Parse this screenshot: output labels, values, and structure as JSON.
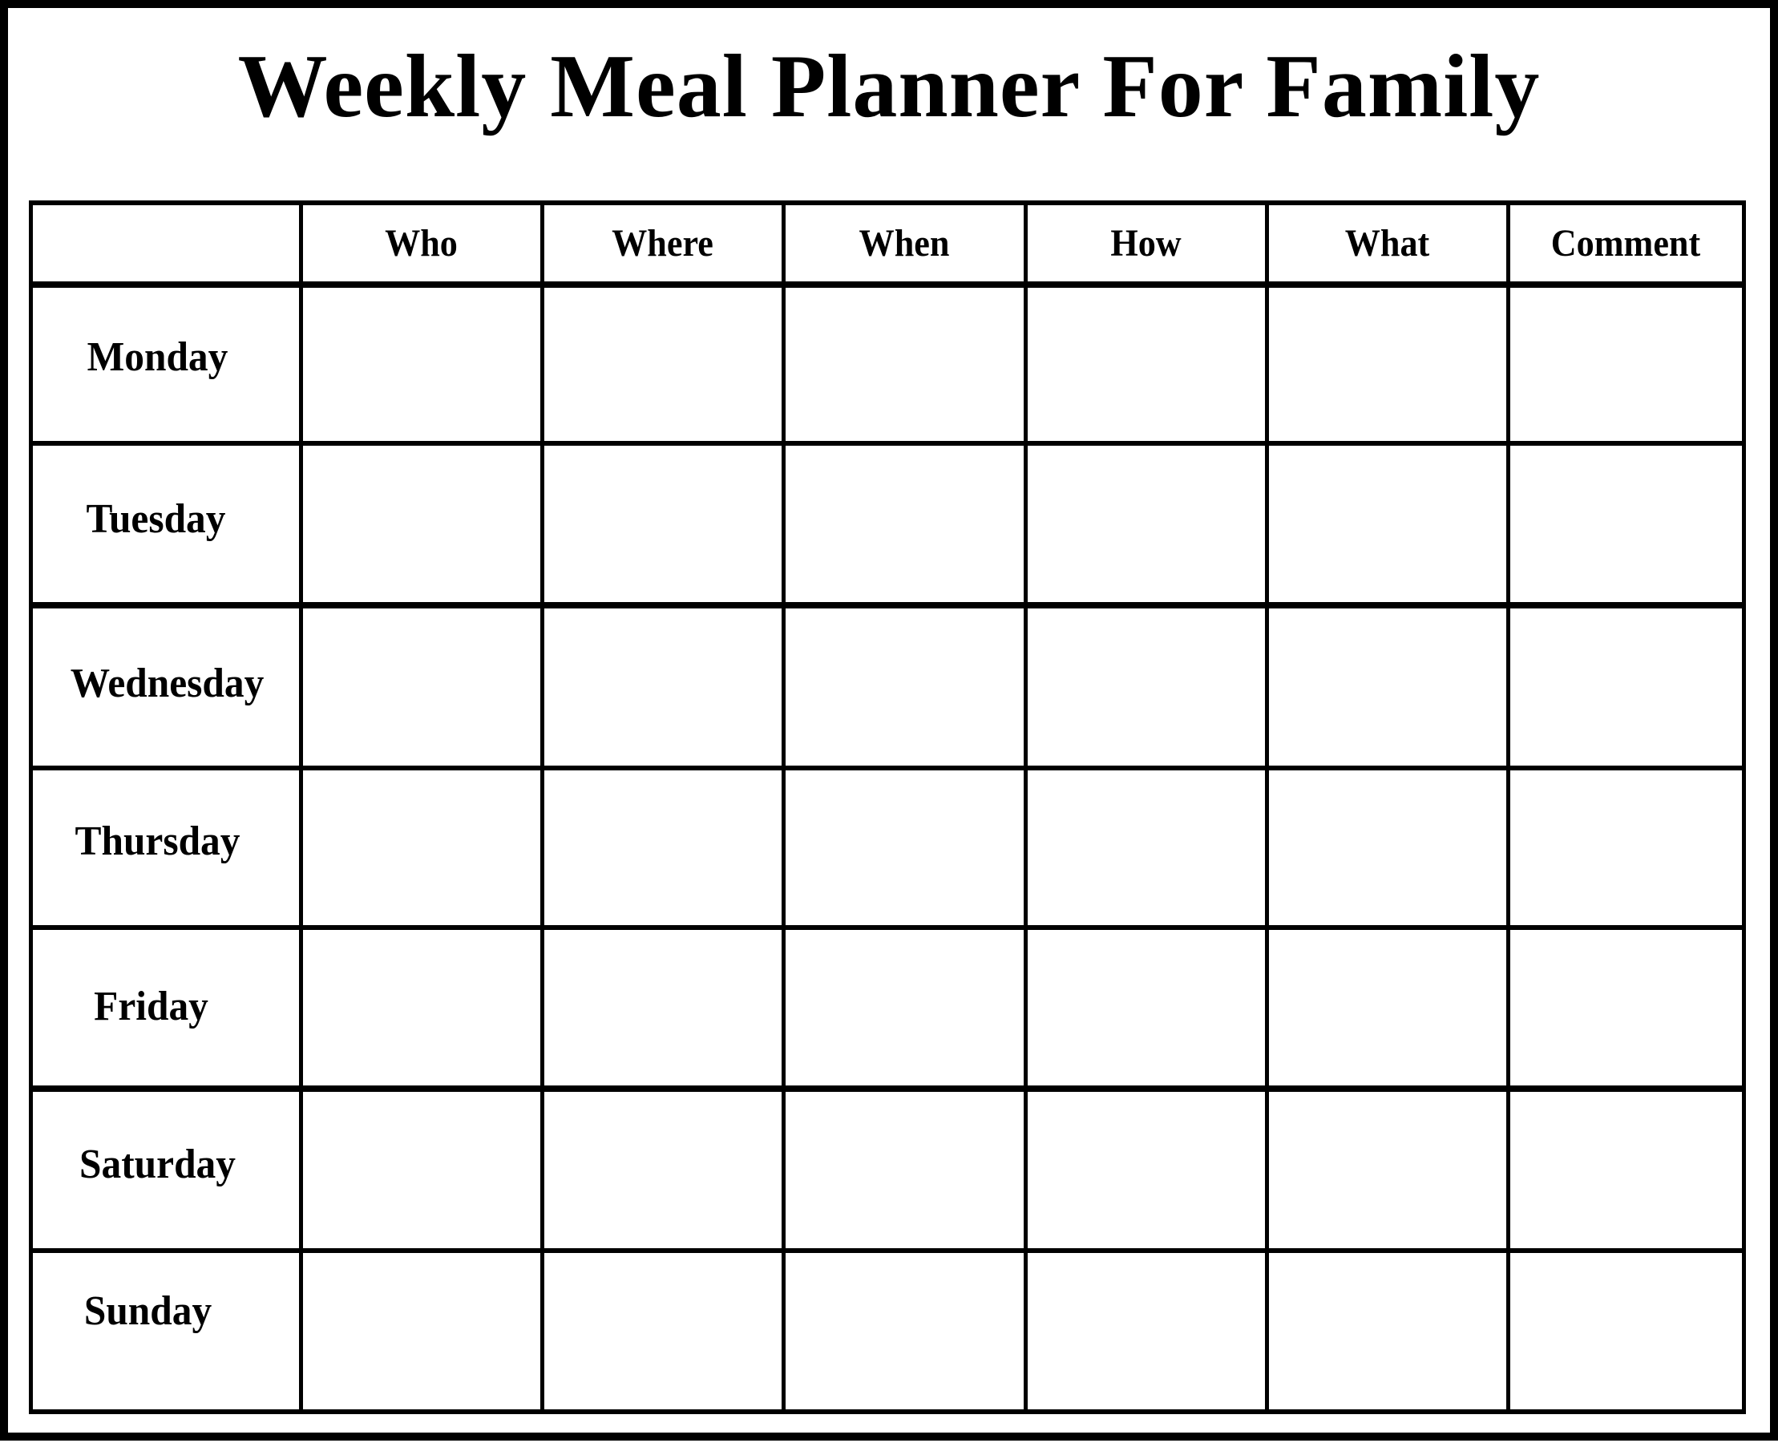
{
  "title": "Weekly Meal Planner For Family",
  "table": {
    "corner_label": "",
    "columns": [
      "Who",
      "Where",
      "When",
      "How",
      "What",
      "Comment"
    ],
    "rows": [
      {
        "day": "Monday",
        "cells": [
          "",
          "",
          "",
          "",
          "",
          ""
        ]
      },
      {
        "day": "Tuesday",
        "cells": [
          "",
          "",
          "",
          "",
          "",
          ""
        ]
      },
      {
        "day": "Wednesday",
        "cells": [
          "",
          "",
          "",
          "",
          "",
          ""
        ]
      },
      {
        "day": "Thursday",
        "cells": [
          "",
          "",
          "",
          "",
          "",
          ""
        ]
      },
      {
        "day": "Friday",
        "cells": [
          "",
          "",
          "",
          "",
          "",
          ""
        ]
      },
      {
        "day": "Saturday",
        "cells": [
          "",
          "",
          "",
          "",
          "",
          ""
        ]
      },
      {
        "day": "Sunday",
        "cells": [
          "",
          "",
          "",
          "",
          "",
          ""
        ]
      }
    ]
  },
  "colors": {
    "line": "#000000",
    "background": "#ffffff"
  }
}
